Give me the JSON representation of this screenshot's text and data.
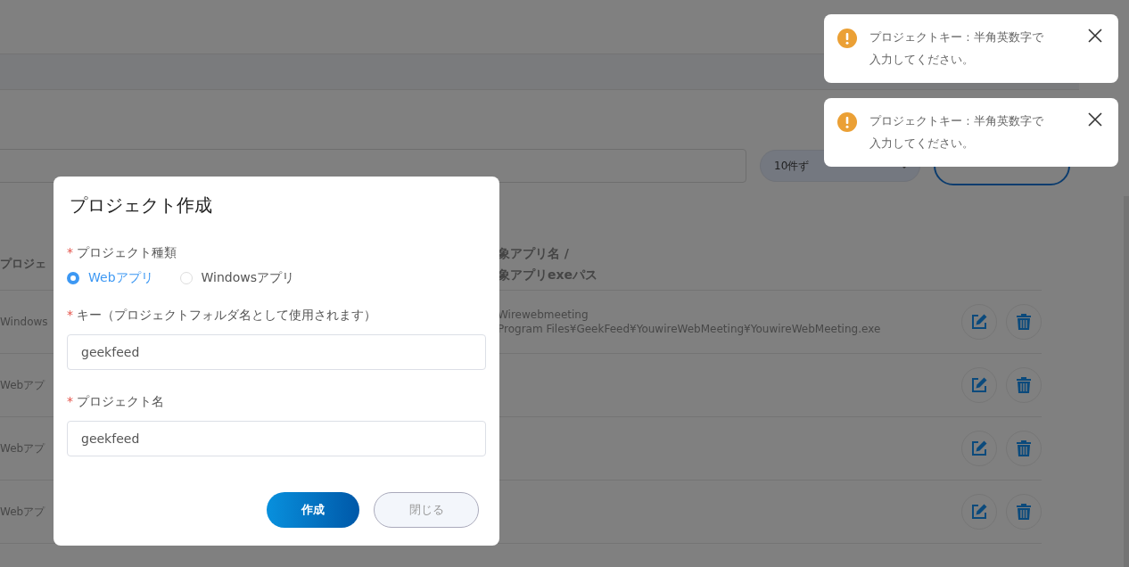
{
  "background_page": {
    "page_size_select": {
      "value": "10件ず"
    },
    "table": {
      "columns": [
        {
          "label": [
            "プロジェ"
          ]
        },
        {
          "label": [
            "象アプリ名 /",
            "象アプリexeパス"
          ]
        }
      ],
      "rows": [
        {
          "type": "Windows",
          "app": [
            "Wirewebmeeting",
            "Program Files¥GeekFeed¥YouwireWebMeeting¥YouwireWebMeeting.exe"
          ]
        },
        {
          "type": "Webアプ"
        },
        {
          "type": "Webアプ"
        },
        {
          "type": "Webアプ"
        }
      ]
    }
  },
  "dialog": {
    "title": "プロジェクト作成",
    "project_type": {
      "mark": "*",
      "label": "プロジェクト種類",
      "options": [
        {
          "label": "Webアプリ",
          "selected": true
        },
        {
          "label": "Windowsアプリ",
          "selected": false
        }
      ]
    },
    "key_field": {
      "mark": "*",
      "label": "キー（プロジェクトフォルダ名として使用されます）",
      "value": "geekfeed"
    },
    "name_field": {
      "mark": "*",
      "label": "プロジェクト名",
      "value": "geekfeed"
    },
    "buttons": [
      {
        "label": "作成",
        "kind": "primary"
      },
      {
        "label": "閉じる",
        "kind": "secondary"
      }
    ]
  },
  "toasts": [
    {
      "kind": "warning",
      "lines": [
        "プロジェクトキー : 半角英数字で",
        "入力してください。"
      ]
    },
    {
      "kind": "warning",
      "lines": [
        "プロジェクトキー : 半角英数字で",
        "入力してください。"
      ]
    }
  ]
}
